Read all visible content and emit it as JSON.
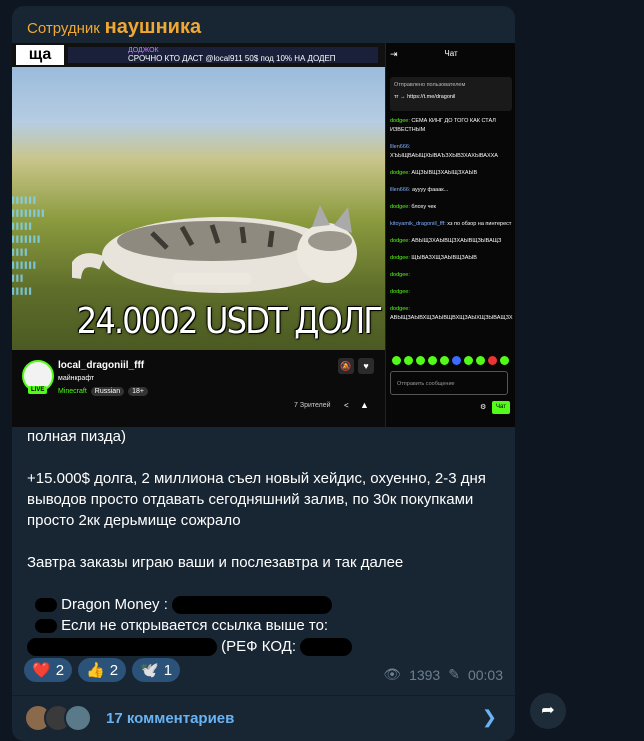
{
  "channel": {
    "title_prefix": "Сотрудник",
    "title_main": "наушника"
  },
  "stream": {
    "banner_logo": "ща",
    "banner_line1": "ДОДЖОК",
    "banner_line2": "СРОЧНО КТО ДАСТ @local911 50$ под 10% НА ДОДЕП",
    "overlay_text": "24.0002 USDT ДОЛГ",
    "streamer": "local_dragoniil_fff",
    "title": "майнкрафт",
    "category": "Minecraft",
    "tags": [
      "Russian",
      "18+"
    ],
    "live_badge": "LIVE",
    "viewers": "7 Зрителей"
  },
  "chat": {
    "header": "Чат",
    "pinned_from": "Отправлено пользователем",
    "pinned_link": "тг → https://t.me/dragonil",
    "messages": [
      {
        "user": "dodgee:",
        "text": "СЕМА КИНГ ДО ТОГО КАК СТАЛ ИЗВЕСТНЫМ"
      },
      {
        "user": "lllen666:",
        "text": "ХЪЫЩВАЫЩХЫВАЪЗХЫВЗХАХЫВАХХА"
      },
      {
        "user": "dodgee:",
        "text": "АЩЗЫВЩЗХАЫЩЗХАЫВ"
      },
      {
        "user": "lllen666:",
        "text": "ауууу фааак..."
      },
      {
        "user": "dodgee:",
        "text": "блоху чек"
      },
      {
        "user": "kitoyamik_dragoniil_fff:",
        "text": "хз по обзор на пинтерест"
      },
      {
        "user": "dodgee:",
        "text": "АВЫЩЗХАЫВЩЗХАЫВЩЗЫВАЩЗ"
      },
      {
        "user": "dodgee:",
        "text": "ЩЫВАЗХЩЗАЫВЩЗАЫВ"
      },
      {
        "user": "dodgee:",
        "text": ""
      },
      {
        "user": "dodgee:",
        "text": ""
      },
      {
        "user": "dodgee:",
        "text": "АВЫЩЗАЫВХЩЗАЫВЩВХЩЗАЫХЩЗЫВАЩЗХ"
      }
    ],
    "input_placeholder": "Отправить сообщение",
    "send_label": "Чат"
  },
  "post": {
    "line1": "полная пизда)",
    "para2": "+15.000$ долга, 2 миллиона съел новый хейдис, охуенно, 2-3 дня выводов просто отдавать сегодняшний залив, по 30к покупками просто 2кк дерьмище сожрало",
    "para3": "Завтра заказы играю ваши и послезавтра и так далее",
    "dragon_label": "Dragon Money :",
    "link_note": "Если не открывается ссылка выше то:",
    "ref_label": "(РЕФ КОД:"
  },
  "reactions": [
    {
      "emoji": "❤️",
      "count": "2"
    },
    {
      "emoji": "👍",
      "count": "2"
    },
    {
      "emoji": "🕊️",
      "count": "1"
    }
  ],
  "meta": {
    "views": "1393",
    "time": "00:03"
  },
  "comments": {
    "label": "17 комментариев"
  },
  "colors": {
    "accent": "#6ab3f3",
    "title": "#f0a832",
    "kick_green": "#53fc18",
    "bubble": "#182533"
  }
}
